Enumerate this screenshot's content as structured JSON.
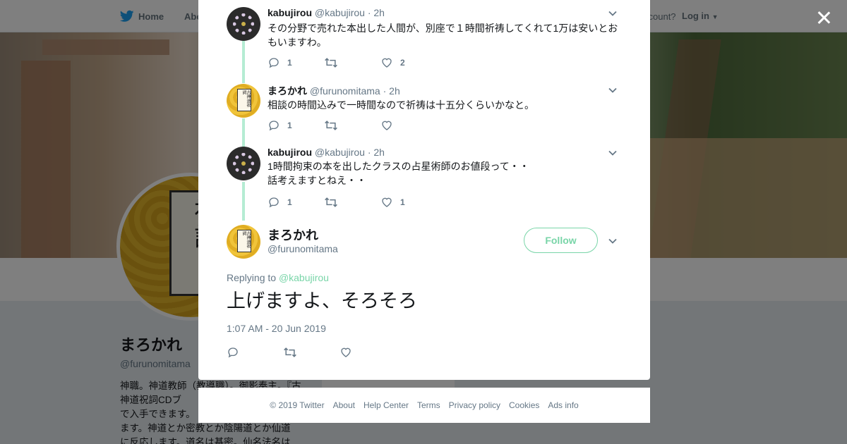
{
  "background": {
    "nav": {
      "home": "Home",
      "about": "Abo",
      "account_prompt": "ccount?",
      "login": "Log in"
    },
    "profile": {
      "name": "まろかれ",
      "handle": "@furunomitama",
      "bio": "神職。神道教師（教導職）。御影奉主。『古神道祝詞CDブ\nで入手できます。\nます。神道とか密教とか陰陽道とか仙道\nに反応します。道名は基密。仙名法名は",
      "avatar_card_text": "古神道祝詞"
    }
  },
  "modal": {
    "replies": [
      {
        "name": "kabujirou",
        "handle": "@kabujirou",
        "sep": "·",
        "time": "2h",
        "text": "その分野で売れた本出した人間が、別座で１時間祈祷してくれて1万は安いとおもいますわ。",
        "replies_count": "1",
        "retweets_count": "",
        "likes_count": "2",
        "avatar": "kabu"
      },
      {
        "name": "まろかれ",
        "handle": "@furunomitama",
        "sep": "·",
        "time": "2h",
        "text": "相談の時間込みで一時間なので祈祷は十五分くらいかなと。",
        "replies_count": "1",
        "retweets_count": "",
        "likes_count": "",
        "avatar": "maro"
      },
      {
        "name": "kabujirou",
        "handle": "@kabujirou",
        "sep": "·",
        "time": "2h",
        "text": "1時間拘束の本を出したクラスの占星術師のお値段って・・\n話考えますとねえ・・",
        "replies_count": "1",
        "retweets_count": "",
        "likes_count": "1",
        "avatar": "kabu"
      }
    ],
    "main_tweet": {
      "name": "まろかれ",
      "handle": "@furunomitama",
      "follow_label": "Follow",
      "replying_prefix": "Replying to ",
      "replying_to": "@kabujirou",
      "text": "上げますよ、そろそろ",
      "timestamp": "1:07 AM - 20 Jun 2019"
    },
    "avatar_card_text": "古神道祝詞"
  },
  "footer": {
    "links": [
      "© 2019 Twitter",
      "About",
      "Help Center",
      "Terms",
      "Privacy policy",
      "Cookies",
      "Ads info"
    ]
  },
  "colors": {
    "accent": "#79d5a8",
    "thread_line": "#b5ecd3",
    "secondary_text": "#657786",
    "overlay": "rgba(0,0,0,0.5)"
  },
  "icons": [
    "twitter-bird-icon",
    "close-icon",
    "chevron-down-icon",
    "reply-icon",
    "retweet-icon",
    "heart-icon",
    "caret-down-icon"
  ]
}
